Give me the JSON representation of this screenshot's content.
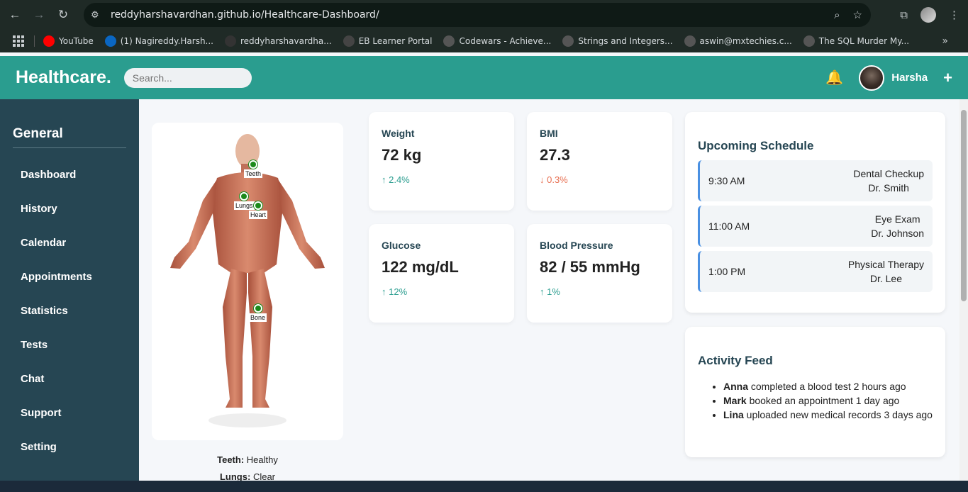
{
  "browser": {
    "url": "reddyharshavardhan.github.io/Healthcare-Dashboard/"
  },
  "bookmarks": [
    {
      "label": "YouTube",
      "icon": "youtube-icon",
      "color": "#ff0000"
    },
    {
      "label": "(1) Nagireddy.Harsh...",
      "icon": "linkedin-icon",
      "color": "#0a66c2"
    },
    {
      "label": "reddyharshavardha...",
      "icon": "github-icon",
      "color": "#333333"
    },
    {
      "label": "EB Learner Portal",
      "icon": "eb-icon",
      "color": "#444444"
    },
    {
      "label": "Codewars - Achieve...",
      "icon": "globe-icon",
      "color": "#555555"
    },
    {
      "label": "Strings and Integers...",
      "icon": "globe-icon",
      "color": "#555555"
    },
    {
      "label": "aswin@mxtechies.c...",
      "icon": "globe-icon",
      "color": "#555555"
    },
    {
      "label": "The SQL Murder My...",
      "icon": "globe-icon",
      "color": "#555555"
    }
  ],
  "header": {
    "logo": "Healthcare.",
    "search_placeholder": "Search...",
    "user": "Harsha"
  },
  "sidebar": {
    "title": "General",
    "items": [
      "Dashboard",
      "History",
      "Calendar",
      "Appointments",
      "Statistics",
      "Tests",
      "Chat",
      "Support",
      "Setting"
    ]
  },
  "anatomy": {
    "labels": {
      "teeth": "Teeth",
      "lungs": "Lungs",
      "heart": "Heart",
      "bone": "Bone"
    },
    "status": [
      {
        "organ": "Teeth:",
        "state": "Healthy"
      },
      {
        "organ": "Lungs:",
        "state": "Clear"
      }
    ]
  },
  "metrics": [
    {
      "title": "Weight",
      "value": "72 kg",
      "change": "↑ 2.4%"
    },
    {
      "title": "BMI",
      "value": "27.3",
      "change": "↓ 0.3%"
    },
    {
      "title": "Glucose",
      "value": "122 mg/dL",
      "change": "↑ 12%"
    },
    {
      "title": "Blood Pressure",
      "value": "82 / 55 mmHg",
      "change": "↑ 1%"
    }
  ],
  "schedule": {
    "title": "Upcoming Schedule",
    "items": [
      {
        "time": "9:30 AM",
        "event": "Dental Checkup",
        "doctor": "Dr. Smith"
      },
      {
        "time": "11:00 AM",
        "event": "Eye Exam",
        "doctor": "Dr. Johnson"
      },
      {
        "time": "1:00 PM",
        "event": "Physical Therapy",
        "doctor": "Dr. Lee"
      }
    ]
  },
  "activity": {
    "title": "Activity Feed",
    "items": [
      {
        "name": "Anna",
        "text": " completed a blood test 2 hours ago"
      },
      {
        "name": "Mark",
        "text": " booked an appointment 1 day ago"
      },
      {
        "name": "Lina",
        "text": " uploaded new medical records 3 days ago"
      }
    ]
  }
}
